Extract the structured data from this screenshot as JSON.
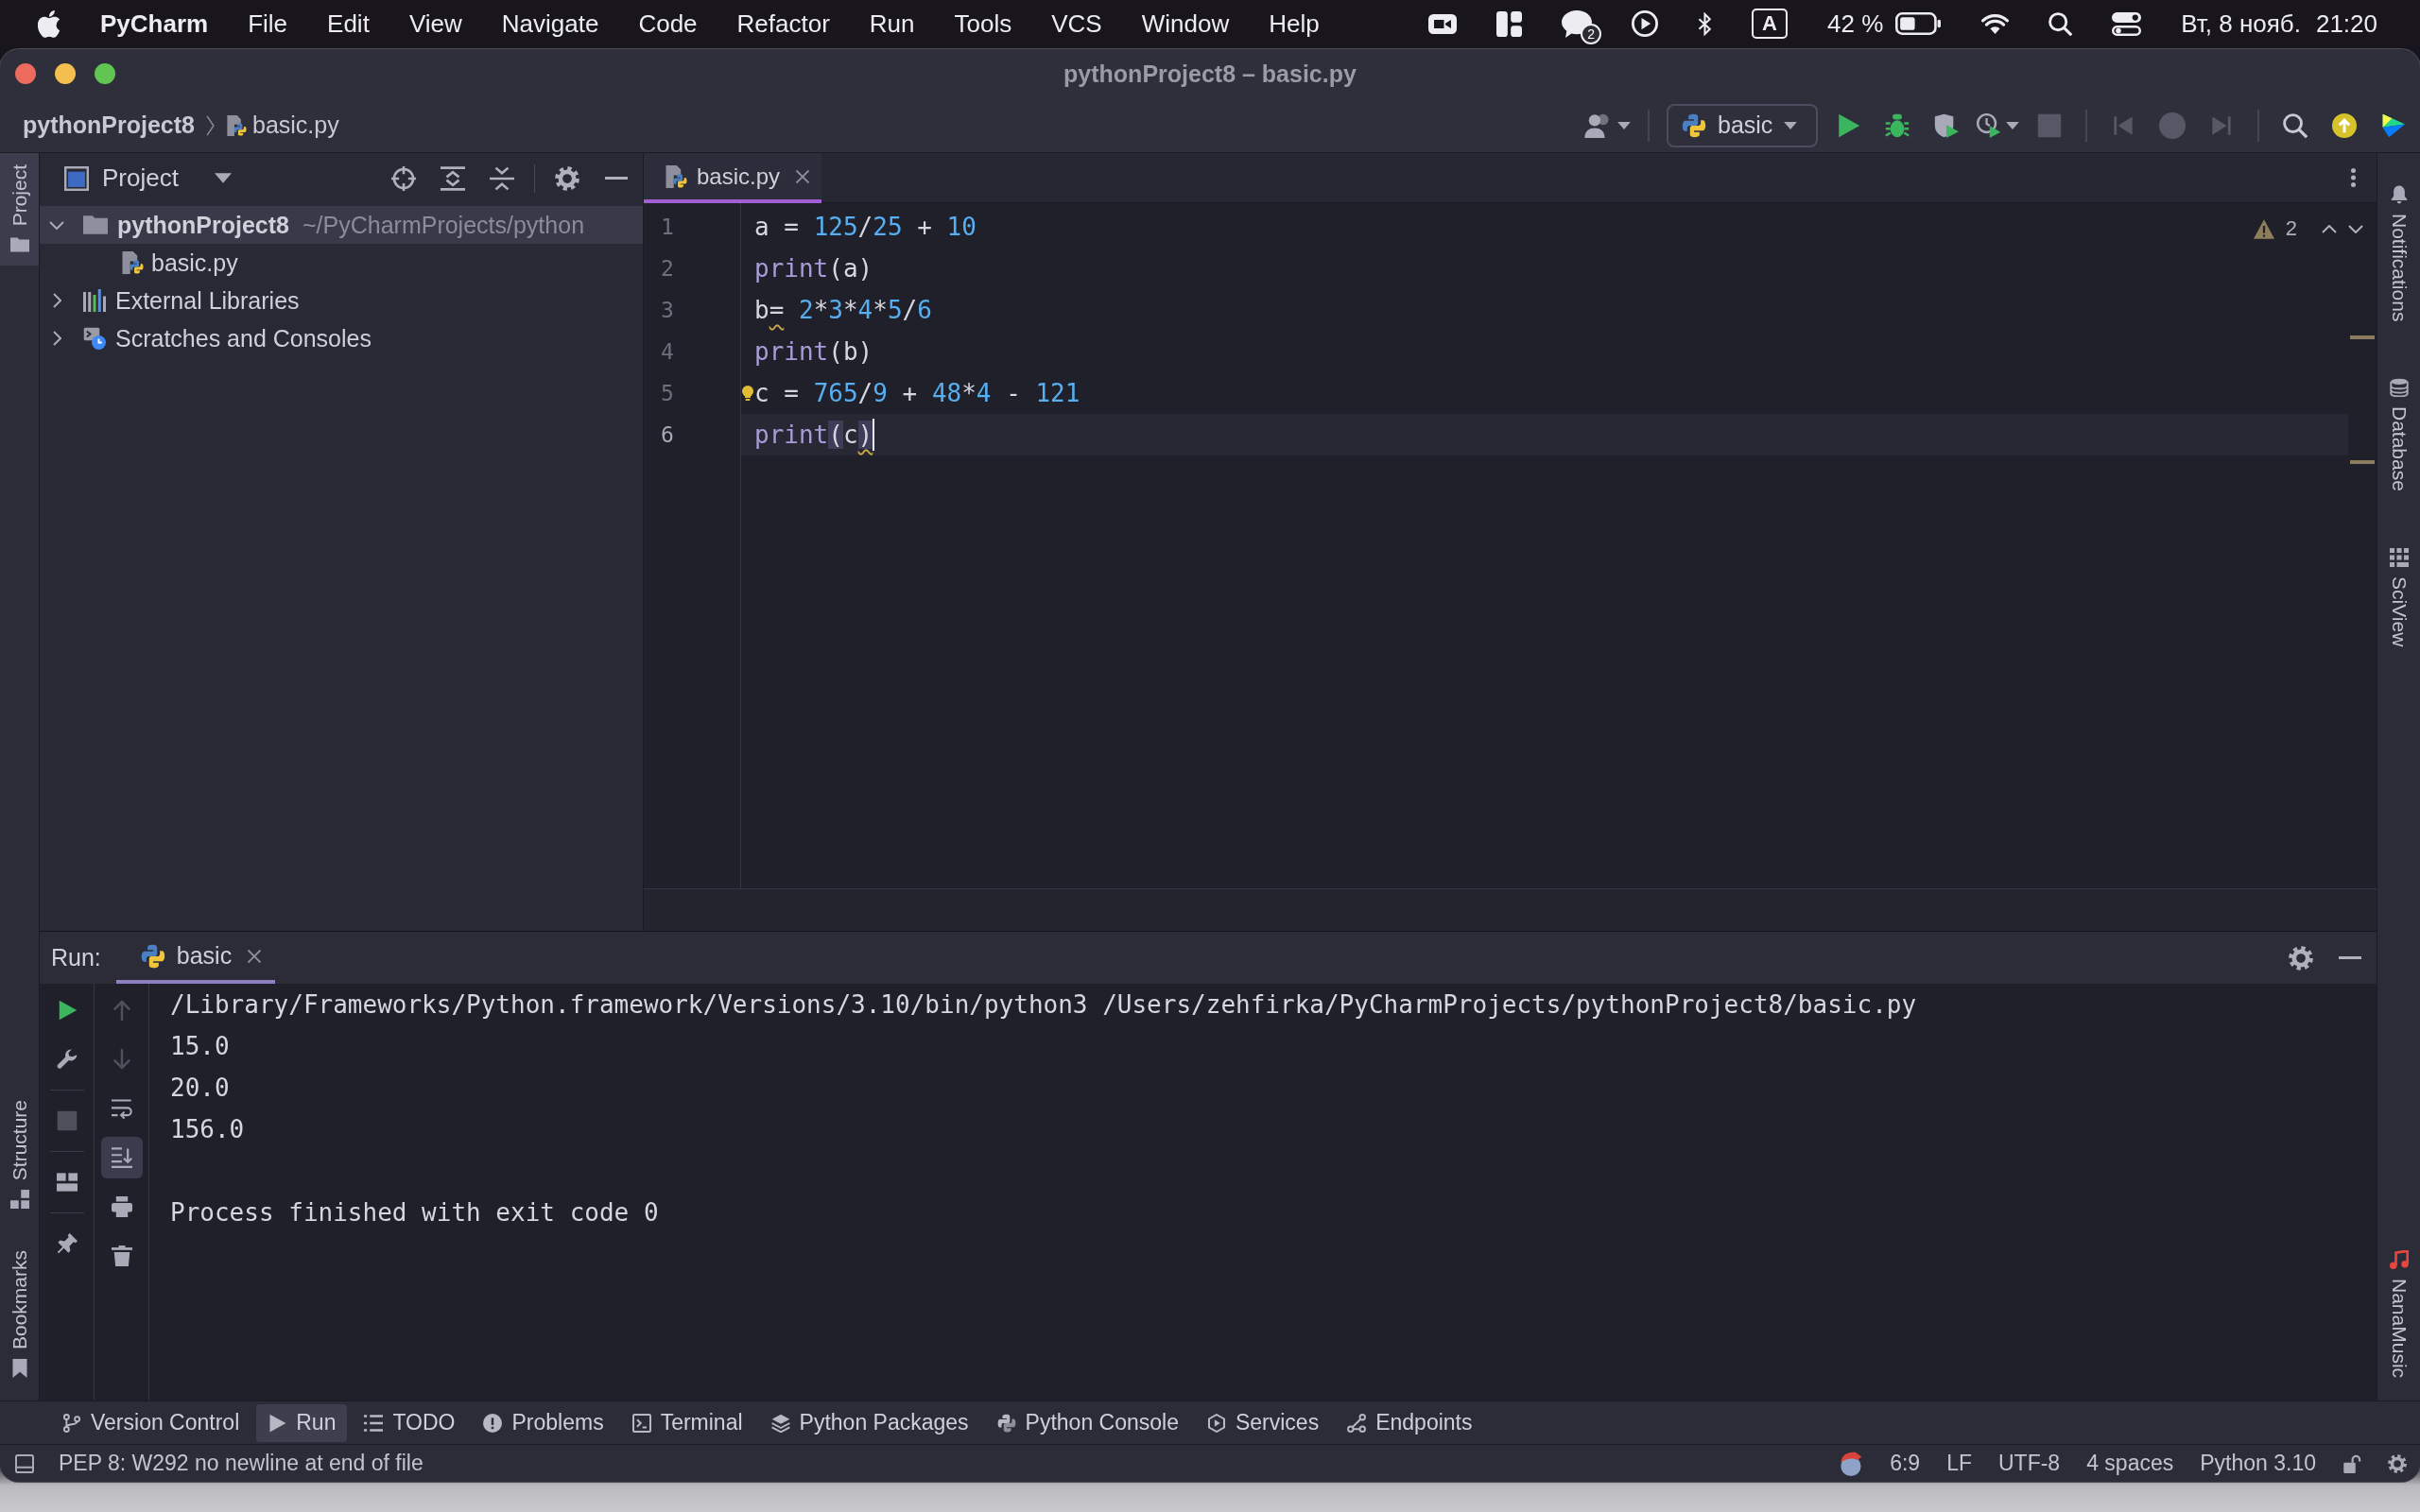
{
  "menu_bar": {
    "app_name": "PyCharm",
    "menus": [
      "File",
      "Edit",
      "View",
      "Navigate",
      "Code",
      "Refactor",
      "Run",
      "Tools",
      "VCS",
      "Window",
      "Help"
    ],
    "notification_count": "2",
    "input_source": "A",
    "battery": "42 %",
    "date": "Вт, 8 нояб.",
    "time": "21:20"
  },
  "window": {
    "title": "pythonProject8 – basic.py"
  },
  "navigation_bar": {
    "breadcrumbs": [
      {
        "label": "pythonProject8",
        "kind": "project"
      },
      {
        "label": "basic.py",
        "kind": "file"
      }
    ],
    "run_configuration": "basic",
    "run_actions": [
      {
        "kind": "run",
        "disabled": false
      },
      {
        "kind": "debug",
        "disabled": false
      },
      {
        "kind": "coverage",
        "disabled": false
      },
      {
        "kind": "profile",
        "disabled": false
      },
      {
        "kind": "stop",
        "disabled": true
      }
    ],
    "navigation_actions": [
      {
        "kind": "back",
        "disabled": true
      },
      {
        "kind": "record",
        "disabled": true
      },
      {
        "kind": "forward",
        "disabled": true
      }
    ]
  },
  "left_tool_strip": {
    "top": [
      {
        "label": "Project",
        "kind": "project",
        "selected": true
      }
    ],
    "bottom": [
      {
        "label": "Structure",
        "kind": "structure",
        "selected": false
      },
      {
        "label": "Bookmarks",
        "kind": "bookmarks",
        "selected": false
      }
    ]
  },
  "project_panel": {
    "title": "Project",
    "tree": [
      {
        "label": "pythonProject8",
        "path": "~/PyCharmProjects/python",
        "kind": "folder",
        "expanded": true,
        "selected": true,
        "children": [
          {
            "label": "basic.py",
            "kind": "python_file",
            "selected": false
          }
        ]
      },
      {
        "label": "External Libraries",
        "kind": "libraries",
        "expanded": false,
        "selected": false
      },
      {
        "label": "Scratches and Consoles",
        "kind": "scratches",
        "expanded": false,
        "selected": false
      }
    ]
  },
  "editor": {
    "tabs": [
      {
        "label": "basic.py",
        "selected": true
      }
    ],
    "warning_count": "2",
    "lines": [
      {
        "number": "1",
        "current": false,
        "bulb": false,
        "tokens": [
          {
            "kind": "name",
            "text": "a",
            "warning": false,
            "matched": false
          },
          {
            "kind": "op",
            "text": " = ",
            "warning": false,
            "matched": false
          },
          {
            "kind": "number",
            "text": "125",
            "warning": false,
            "matched": false
          },
          {
            "kind": "op",
            "text": "/",
            "warning": false,
            "matched": false
          },
          {
            "kind": "number",
            "text": "25",
            "warning": false,
            "matched": false
          },
          {
            "kind": "op",
            "text": " + ",
            "warning": false,
            "matched": false
          },
          {
            "kind": "number",
            "text": "10",
            "warning": false,
            "matched": false
          }
        ]
      },
      {
        "number": "2",
        "current": false,
        "bulb": false,
        "tokens": [
          {
            "kind": "builtin",
            "text": "print",
            "warning": false,
            "matched": false
          },
          {
            "kind": "op",
            "text": "(a)",
            "warning": false,
            "matched": false
          }
        ]
      },
      {
        "number": "3",
        "current": false,
        "bulb": false,
        "tokens": [
          {
            "kind": "name",
            "text": "b",
            "warning": false,
            "matched": false
          },
          {
            "kind": "op",
            "text": "=",
            "warning": true,
            "matched": false
          },
          {
            "kind": "number",
            "text": " 2",
            "warning": false,
            "matched": false
          },
          {
            "kind": "op",
            "text": "*",
            "warning": false,
            "matched": false
          },
          {
            "kind": "number",
            "text": "3",
            "warning": false,
            "matched": false
          },
          {
            "kind": "op",
            "text": "*",
            "warning": false,
            "matched": false
          },
          {
            "kind": "number",
            "text": "4",
            "warning": false,
            "matched": false
          },
          {
            "kind": "op",
            "text": "*",
            "warning": false,
            "matched": false
          },
          {
            "kind": "number",
            "text": "5",
            "warning": false,
            "matched": false
          },
          {
            "kind": "op",
            "text": "/",
            "warning": false,
            "matched": false
          },
          {
            "kind": "number",
            "text": "6",
            "warning": false,
            "matched": false
          }
        ]
      },
      {
        "number": "4",
        "current": false,
        "bulb": false,
        "tokens": [
          {
            "kind": "builtin",
            "text": "print",
            "warning": false,
            "matched": false
          },
          {
            "kind": "op",
            "text": "(b)",
            "warning": false,
            "matched": false
          }
        ]
      },
      {
        "number": "5",
        "current": false,
        "bulb": true,
        "tokens": [
          {
            "kind": "name",
            "text": "c",
            "warning": false,
            "matched": false
          },
          {
            "kind": "op",
            "text": " = ",
            "warning": false,
            "matched": false
          },
          {
            "kind": "number",
            "text": "765",
            "warning": false,
            "matched": false
          },
          {
            "kind": "op",
            "text": "/",
            "warning": false,
            "matched": false
          },
          {
            "kind": "number",
            "text": "9",
            "warning": false,
            "matched": false
          },
          {
            "kind": "op",
            "text": " + ",
            "warning": false,
            "matched": false
          },
          {
            "kind": "number",
            "text": "48",
            "warning": false,
            "matched": false
          },
          {
            "kind": "op",
            "text": "*",
            "warning": false,
            "matched": false
          },
          {
            "kind": "number",
            "text": "4",
            "warning": false,
            "matched": false
          },
          {
            "kind": "op",
            "text": " - ",
            "warning": false,
            "matched": false
          },
          {
            "kind": "number",
            "text": "121",
            "warning": false,
            "matched": false
          }
        ]
      },
      {
        "number": "6",
        "current": true,
        "bulb": false,
        "tokens": [
          {
            "kind": "builtin",
            "text": "print",
            "warning": false,
            "matched": false
          },
          {
            "kind": "op",
            "text": "(",
            "warning": false,
            "matched": true
          },
          {
            "kind": "name",
            "text": "c",
            "warning": false,
            "matched": false
          },
          {
            "kind": "op",
            "text": ")",
            "warning": true,
            "matched": true
          }
        ]
      }
    ]
  },
  "right_tool_strip": {
    "top": [
      {
        "label": "Notifications",
        "kind": "notifications",
        "selected": false
      },
      {
        "label": "Database",
        "kind": "database",
        "selected": false
      },
      {
        "label": "SciView",
        "kind": "sciview",
        "selected": false
      }
    ],
    "bottom": [
      {
        "label": "NanaMusic",
        "kind": "music",
        "selected": false
      }
    ]
  },
  "run_panel": {
    "label": "Run:",
    "tabs": [
      {
        "label": "basic",
        "selected": true
      }
    ],
    "actions": [
      [
        {
          "kind": "rerun",
          "disabled": false,
          "on": false
        },
        {
          "kind": "settings",
          "disabled": false,
          "on": false
        }
      ],
      [
        {
          "kind": "stop",
          "disabled": true,
          "on": false
        }
      ],
      [
        {
          "kind": "layout",
          "disabled": false,
          "on": false
        }
      ],
      [
        {
          "kind": "pin",
          "disabled": false,
          "on": false
        }
      ]
    ],
    "output_actions": [
      {
        "kind": "up",
        "disabled": true,
        "on": false
      },
      {
        "kind": "down",
        "disabled": true,
        "on": false
      },
      {
        "kind": "wrap",
        "disabled": false,
        "on": false
      },
      {
        "kind": "scroll_end",
        "disabled": false,
        "on": true
      },
      {
        "kind": "print",
        "disabled": false,
        "on": false
      },
      {
        "kind": "clear",
        "disabled": false,
        "on": false
      }
    ],
    "output": [
      {
        "kind": "command",
        "text": "/Library/Frameworks/Python.framework/Versions/3.10/bin/python3 /Users/zehfirka/PyCharmProjects/pythonProject8/basic.py"
      },
      {
        "kind": "stdout",
        "text": "15.0"
      },
      {
        "kind": "stdout",
        "text": "20.0"
      },
      {
        "kind": "stdout",
        "text": "156.0"
      },
      {
        "kind": "exit",
        "text": "Process finished with exit code 0"
      }
    ]
  },
  "tool_window_bar": [
    {
      "label": "Version Control",
      "kind": "vcs",
      "selected": false
    },
    {
      "label": "Run",
      "kind": "run",
      "selected": true
    },
    {
      "label": "TODO",
      "kind": "todo",
      "selected": false
    },
    {
      "label": "Problems",
      "kind": "problems",
      "selected": false
    },
    {
      "label": "Terminal",
      "kind": "terminal",
      "selected": false
    },
    {
      "label": "Python Packages",
      "kind": "packages",
      "selected": false
    },
    {
      "label": "Python Console",
      "kind": "console",
      "selected": false
    },
    {
      "label": "Services",
      "kind": "services",
      "selected": false
    },
    {
      "label": "Endpoints",
      "kind": "endpoints",
      "selected": false
    }
  ],
  "status_bar": {
    "message": "PEP 8: W292 no newline at end of file",
    "caret_position": "6:9",
    "line_separator": "LF",
    "encoding": "UTF-8",
    "indent": "4 spaces",
    "interpreter": "Python 3.10"
  }
}
